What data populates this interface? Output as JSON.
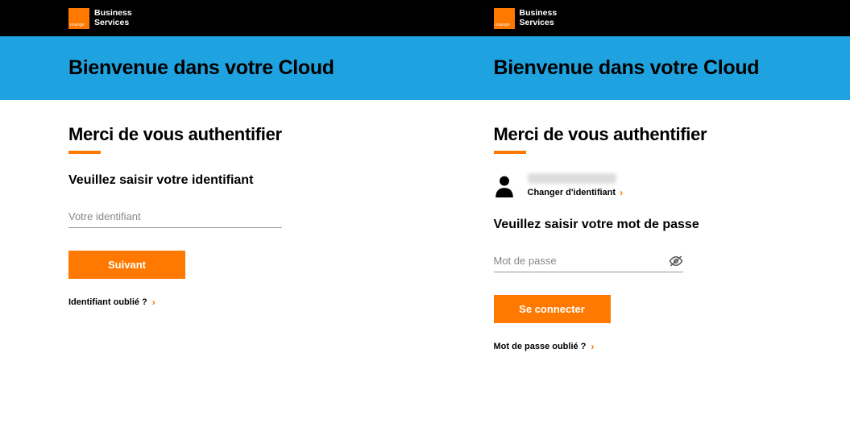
{
  "brand": {
    "line1": "Business",
    "line2": "Services"
  },
  "left": {
    "banner_title": "Bienvenue dans votre Cloud",
    "auth_title": "Merci de vous authentifier",
    "prompt": "Veuillez saisir votre identifiant",
    "input_placeholder": "Votre identifiant",
    "button_label": "Suivant",
    "forgot_label": "Identifiant oublié ?"
  },
  "right": {
    "banner_title": "Bienvenue dans votre Cloud",
    "auth_title": "Merci de vous authentifier",
    "change_id_label": "Changer d'identifiant",
    "prompt": "Veuillez saisir votre mot de passe",
    "input_placeholder": "Mot de passe",
    "button_label": "Se connecter",
    "forgot_label": "Mot de passe oublié ?"
  }
}
